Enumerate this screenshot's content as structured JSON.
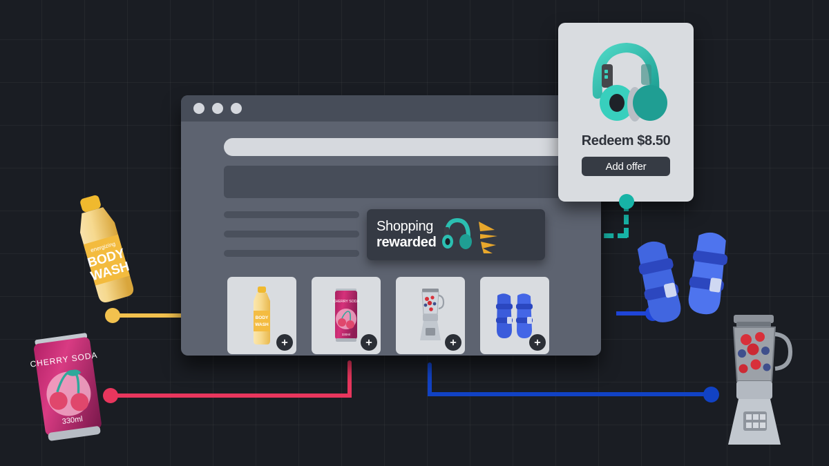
{
  "background": {
    "color": "#1a1d23",
    "grid": true
  },
  "browser": {
    "window_dots": [
      "dot-1",
      "dot-2",
      "dot-3"
    ],
    "search": {
      "value": "",
      "placeholder": "",
      "icon": "search-icon"
    },
    "placeholders": {
      "hero": "",
      "lines": [
        "",
        "",
        ""
      ]
    },
    "products": [
      {
        "name": "body-wash",
        "label": "BODY WASH",
        "sub": "energizing",
        "add_label": "+"
      },
      {
        "name": "cherry-soda",
        "label": "CHERRY SODA",
        "sub": "330ml",
        "add_label": "+"
      },
      {
        "name": "blender",
        "label": "Blender",
        "sub": "",
        "add_label": "+"
      },
      {
        "name": "sandals",
        "label": "Sandals",
        "sub": "",
        "add_label": "+"
      }
    ]
  },
  "promo": {
    "line1": "Shopping",
    "line2": "rewarded",
    "icon": "headphones-icon",
    "burst_color": "#e8a72c",
    "headphone_color": "#2bbfb1"
  },
  "offer": {
    "product": "headphones",
    "price_label": "Redeem $8.50",
    "button_label": "Add offer",
    "accent": "#17b3a6"
  },
  "connectors": [
    {
      "name": "yellow-connector",
      "color": "#f2c14e",
      "style": "solid",
      "from": "body-wash",
      "to": "browser"
    },
    {
      "name": "pink-connector",
      "color": "#e8365d",
      "style": "solid",
      "from": "cherry-soda",
      "to": "product-card-soda"
    },
    {
      "name": "blue-connector",
      "color": "#1f45d8",
      "style": "solid",
      "from": "browser",
      "to": "sandals"
    },
    {
      "name": "blue-connector-lower",
      "color": "#1142c4",
      "style": "solid",
      "from": "product-card-blender",
      "to": "blender"
    },
    {
      "name": "teal-connector",
      "color": "#17b3a6",
      "style": "dashed",
      "from": "offer-card",
      "to": "promo-banner"
    }
  ],
  "artwork": {
    "body_wash": {
      "label_top": "energizing",
      "label_main_1": "BODY",
      "label_main_2": "WASH",
      "color": "#f3bb3e"
    },
    "cherry_soda": {
      "label": "CHERRY SODA",
      "volume": "330ml",
      "color": "#c42a6e"
    },
    "sandals": {
      "color": "#2f4fd8"
    },
    "blender": {
      "color": "#b9bdc4"
    }
  }
}
